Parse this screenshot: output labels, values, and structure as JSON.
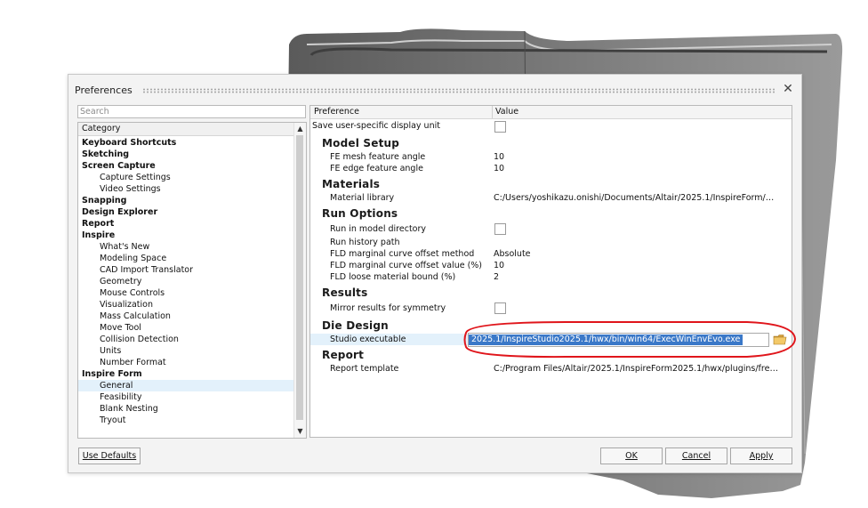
{
  "dialog": {
    "title": "Preferences",
    "search_placeholder": "Search",
    "category_header": "Category",
    "categories": [
      {
        "label": "Keyboard Shortcuts",
        "level": 0
      },
      {
        "label": "Sketching",
        "level": 0
      },
      {
        "label": "Screen Capture",
        "level": 0
      },
      {
        "label": "Capture Settings",
        "level": 1
      },
      {
        "label": "Video Settings",
        "level": 1
      },
      {
        "label": "Snapping",
        "level": 0
      },
      {
        "label": "Design Explorer",
        "level": 0
      },
      {
        "label": "Report",
        "level": 0
      },
      {
        "label": "Inspire",
        "level": 0
      },
      {
        "label": "What's New",
        "level": 1
      },
      {
        "label": "Modeling Space",
        "level": 1
      },
      {
        "label": "CAD Import Translator",
        "level": 1
      },
      {
        "label": "Geometry",
        "level": 1
      },
      {
        "label": "Mouse Controls",
        "level": 1
      },
      {
        "label": "Visualization",
        "level": 1
      },
      {
        "label": "Mass Calculation",
        "level": 1
      },
      {
        "label": "Move Tool",
        "level": 1
      },
      {
        "label": "Collision Detection",
        "level": 1
      },
      {
        "label": "Units",
        "level": 1
      },
      {
        "label": "Number Format",
        "level": 1
      },
      {
        "label": "Inspire Form",
        "level": 0
      },
      {
        "label": "General",
        "level": 1,
        "selected": true
      },
      {
        "label": "Feasibility",
        "level": 1
      },
      {
        "label": "Blank Nesting",
        "level": 1
      },
      {
        "label": "Tryout",
        "level": 1
      }
    ],
    "pref_header": "Preference",
    "value_header": "Value",
    "top_pref": "Save user-specific display unit",
    "sections": {
      "model_setup": {
        "title": "Model Setup",
        "fe_mesh_label": "FE mesh feature angle",
        "fe_mesh_value": "10",
        "fe_edge_label": "FE edge feature angle",
        "fe_edge_value": "10"
      },
      "materials": {
        "title": "Materials",
        "library_label": "Material library",
        "library_value": "C:/Users/yoshikazu.onishi/Documents/Altair/2025.1/InspireForm/…"
      },
      "run_options": {
        "title": "Run Options",
        "run_in_dir_label": "Run in model directory",
        "history_label": "Run history path",
        "fld_method_label": "FLD marginal curve offset method",
        "fld_method_value": "Absolute",
        "fld_value_label": "FLD marginal curve offset value (%)",
        "fld_value_value": "10",
        "fld_loose_label": "FLD loose material bound (%)",
        "fld_loose_value": "2"
      },
      "results": {
        "title": "Results",
        "mirror_label": "Mirror results for symmetry"
      },
      "die_design": {
        "title": "Die Design",
        "studio_label": "Studio executable",
        "studio_value": "2025.1/InspireStudio2025.1/hwx/bin/win64/ExecWinEnvEvo.exe"
      },
      "report": {
        "title": "Report",
        "template_label": "Report template",
        "template_value": "C:/Program Files/Altair/2025.1/InspireForm2025.1/hwx/plugins/fre…"
      }
    },
    "buttons": {
      "use_defaults": "Use Defaults",
      "ok": "OK",
      "cancel": "Cancel",
      "apply": "Apply"
    }
  },
  "icons": {
    "close": "close-icon",
    "folder": "folder-icon",
    "scroll_up": "chevron-up-icon",
    "scroll_down": "chevron-down-icon"
  },
  "colors": {
    "selection": "#e3f1fb",
    "highlight_text_bg": "#3a78c8",
    "annotation_ellipse": "#e0151b"
  }
}
